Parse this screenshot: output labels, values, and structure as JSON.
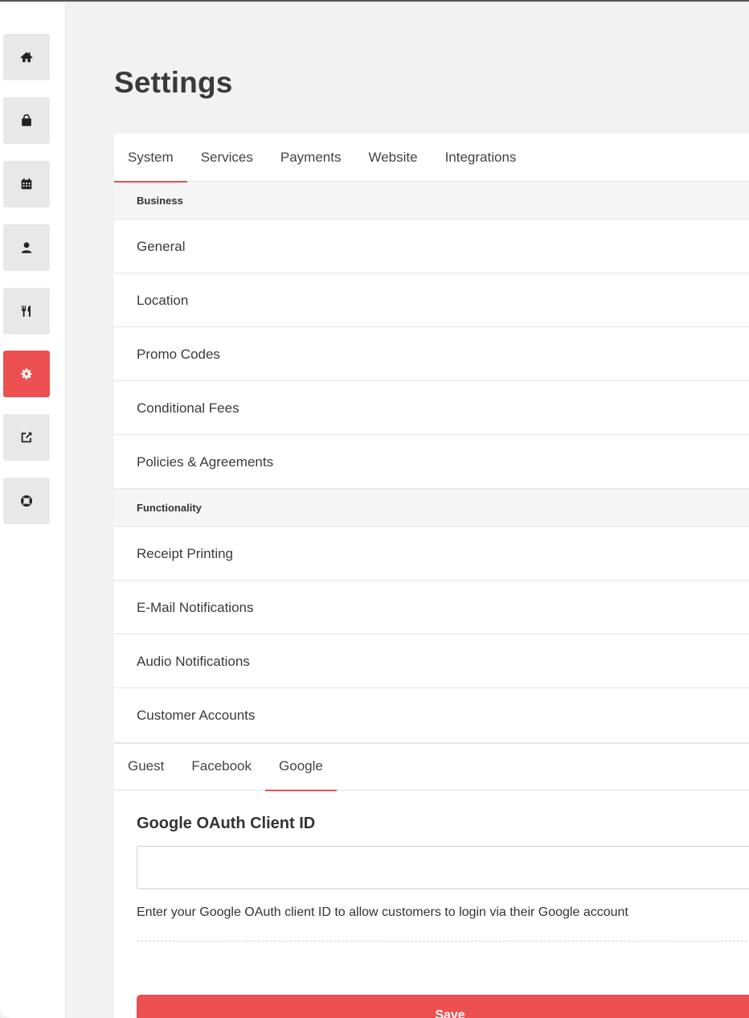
{
  "page": {
    "title": "Settings"
  },
  "sidebar": {
    "items": [
      {
        "icon": "home-icon",
        "active": false
      },
      {
        "icon": "shopping-bag-icon",
        "active": false
      },
      {
        "icon": "calendar-icon",
        "active": false
      },
      {
        "icon": "user-icon",
        "active": false
      },
      {
        "icon": "utensils-icon",
        "active": false
      },
      {
        "icon": "gear-icon",
        "active": true
      },
      {
        "icon": "external-link-icon",
        "active": false
      },
      {
        "icon": "life-ring-icon",
        "active": false
      }
    ],
    "active_color": "#ec5050"
  },
  "tabs": [
    "System",
    "Services",
    "Payments",
    "Website",
    "Integrations"
  ],
  "active_tab": "System",
  "sections": [
    {
      "heading": "Business",
      "items": [
        "General",
        "Location",
        "Promo Codes",
        "Conditional Fees",
        "Policies & Agreements"
      ]
    },
    {
      "heading": "Functionality",
      "items": [
        "Receipt Printing",
        "E-Mail Notifications",
        "Audio Notifications",
        "Customer Accounts"
      ]
    }
  ],
  "subtabs": [
    "Guest",
    "Facebook",
    "Google"
  ],
  "active_subtab": "Google",
  "form": {
    "label": "Google OAuth Client ID",
    "value": "",
    "help": "Enter your Google OAuth client ID to allow customers to login via their Google account",
    "save_label": "Save"
  },
  "accent_color": "#ec5050"
}
